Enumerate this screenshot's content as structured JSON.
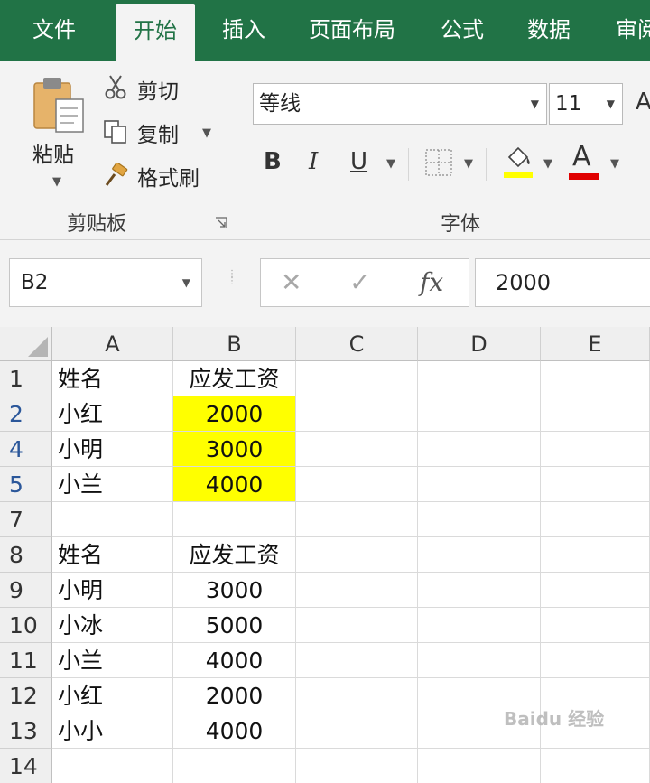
{
  "tabs": [
    {
      "label": "文件",
      "active": false
    },
    {
      "label": "开始",
      "active": true
    },
    {
      "label": "插入",
      "active": false
    },
    {
      "label": "页面布局",
      "active": false
    },
    {
      "label": "公式",
      "active": false
    },
    {
      "label": "数据",
      "active": false
    },
    {
      "label": "审阅",
      "active": false
    }
  ],
  "ribbon": {
    "clipboard": {
      "paste_label": "粘贴",
      "cut_label": "剪切",
      "copy_label": "复制",
      "format_painter_label": "格式刷",
      "group_label": "剪贴板"
    },
    "font": {
      "font_name": "等线",
      "font_size": "11",
      "bold_label": "B",
      "italic_label": "I",
      "underline_label": "U",
      "font_color_label": "A",
      "group_label": "字体",
      "highlight_color": "#ffff00",
      "font_color": "#e00000"
    }
  },
  "formula_bar": {
    "name_box": "B2",
    "fx_label": "fx",
    "value": "2000"
  },
  "sheet": {
    "columns": [
      "A",
      "B",
      "C",
      "D",
      "E"
    ],
    "rows": [
      {
        "num": "1",
        "a": "姓名",
        "b": "应发工资",
        "selected": false,
        "highlight": false
      },
      {
        "num": "2",
        "a": "小红",
        "b": "2000",
        "selected": true,
        "highlight": true
      },
      {
        "num": "4",
        "a": "小明",
        "b": "3000",
        "selected": true,
        "highlight": true
      },
      {
        "num": "5",
        "a": "小兰",
        "b": "4000",
        "selected": true,
        "highlight": true
      },
      {
        "num": "7",
        "a": "",
        "b": "",
        "selected": false,
        "highlight": false
      },
      {
        "num": "8",
        "a": "姓名",
        "b": "应发工资",
        "selected": false,
        "highlight": false
      },
      {
        "num": "9",
        "a": "小明",
        "b": "3000",
        "selected": false,
        "highlight": false
      },
      {
        "num": "10",
        "a": "小冰",
        "b": "5000",
        "selected": false,
        "highlight": false
      },
      {
        "num": "11",
        "a": "小兰",
        "b": "4000",
        "selected": false,
        "highlight": false
      },
      {
        "num": "12",
        "a": "小红",
        "b": "2000",
        "selected": false,
        "highlight": false
      },
      {
        "num": "13",
        "a": "小小",
        "b": "4000",
        "selected": false,
        "highlight": false
      },
      {
        "num": "14",
        "a": "",
        "b": "",
        "selected": false,
        "highlight": false
      }
    ],
    "highlight_color": "#ffff00"
  },
  "watermark": "Baidu 经验"
}
